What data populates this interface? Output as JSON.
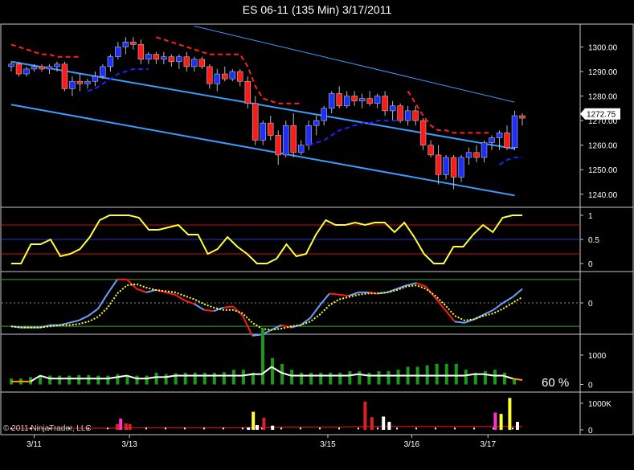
{
  "title": "ES 06-11 (135 Min)  3/17/2011",
  "copyright": "© 2011 NinjaTrader, LLC",
  "colors": {
    "up": "#1e2eff",
    "down": "#ff1a1a",
    "channel": "#3a9cff",
    "stop_down": "#ff2020",
    "stop_up": "#2020ff",
    "yellow": "#ffff33",
    "fast": "#6aa0ff",
    "volume": "#1a9a1a"
  },
  "chart_data": [
    {
      "type": "candlestick",
      "ylim": [
        1236,
        1308
      ],
      "yticks": [
        "1300.00",
        "1290.00",
        "1280.00",
        "1270.00",
        "1260.00",
        "1250.00",
        "1240.00"
      ],
      "last_price": "1272.75",
      "x_labels": [
        "3/11",
        "3/13",
        "3/15",
        "3/16",
        "3/17"
      ],
      "candles": [
        [
          1292,
          1294,
          1290,
          1293
        ],
        [
          1293,
          1294,
          1288,
          1289
        ],
        [
          1289,
          1292,
          1288,
          1291
        ],
        [
          1291,
          1293,
          1290,
          1292
        ],
        [
          1292,
          1293,
          1290,
          1291
        ],
        [
          1291,
          1293,
          1289,
          1292
        ],
        [
          1292,
          1294,
          1290,
          1293
        ],
        [
          1293,
          1294,
          1282,
          1283
        ],
        [
          1283,
          1288,
          1280,
          1286
        ],
        [
          1286,
          1289,
          1282,
          1285
        ],
        [
          1285,
          1287,
          1283,
          1286
        ],
        [
          1286,
          1290,
          1284,
          1288
        ],
        [
          1288,
          1293,
          1287,
          1292
        ],
        [
          1292,
          1297,
          1290,
          1296
        ],
        [
          1296,
          1302,
          1295,
          1300
        ],
        [
          1300,
          1304,
          1297,
          1302
        ],
        [
          1302,
          1304,
          1299,
          1301
        ],
        [
          1301,
          1303,
          1293,
          1295
        ],
        [
          1295,
          1298,
          1293,
          1297
        ],
        [
          1297,
          1298,
          1293,
          1295
        ],
        [
          1295,
          1298,
          1293,
          1296
        ],
        [
          1296,
          1297,
          1292,
          1294
        ],
        [
          1294,
          1297,
          1291,
          1296
        ],
        [
          1296,
          1298,
          1290,
          1292
        ],
        [
          1292,
          1296,
          1290,
          1295
        ],
        [
          1295,
          1296,
          1291,
          1292
        ],
        [
          1292,
          1293,
          1283,
          1285
        ],
        [
          1285,
          1291,
          1282,
          1289
        ],
        [
          1289,
          1292,
          1286,
          1287
        ],
        [
          1287,
          1291,
          1286,
          1290
        ],
        [
          1290,
          1291,
          1284,
          1286
        ],
        [
          1286,
          1288,
          1275,
          1277
        ],
        [
          1277,
          1280,
          1260,
          1262
        ],
        [
          1262,
          1270,
          1260,
          1269
        ],
        [
          1269,
          1272,
          1262,
          1264
        ],
        [
          1264,
          1266,
          1252,
          1256
        ],
        [
          1256,
          1270,
          1255,
          1268
        ],
        [
          1268,
          1273,
          1255,
          1257
        ],
        [
          1257,
          1262,
          1256,
          1260
        ],
        [
          1260,
          1270,
          1258,
          1268
        ],
        [
          1268,
          1272,
          1264,
          1270
        ],
        [
          1270,
          1276,
          1268,
          1275
        ],
        [
          1275,
          1282,
          1273,
          1281
        ],
        [
          1281,
          1284,
          1275,
          1276
        ],
        [
          1276,
          1282,
          1275,
          1280
        ],
        [
          1280,
          1282,
          1276,
          1278
        ],
        [
          1278,
          1281,
          1275,
          1279
        ],
        [
          1279,
          1282,
          1276,
          1277
        ],
        [
          1277,
          1281,
          1275,
          1280
        ],
        [
          1280,
          1282,
          1272,
          1274
        ],
        [
          1274,
          1278,
          1270,
          1276
        ],
        [
          1276,
          1277,
          1269,
          1270
        ],
        [
          1270,
          1276,
          1268,
          1274
        ],
        [
          1274,
          1276,
          1268,
          1270
        ],
        [
          1270,
          1271,
          1258,
          1260
        ],
        [
          1260,
          1262,
          1255,
          1256
        ],
        [
          1256,
          1260,
          1244,
          1248
        ],
        [
          1248,
          1256,
          1246,
          1255
        ],
        [
          1255,
          1256,
          1242,
          1247
        ],
        [
          1247,
          1256,
          1245,
          1255
        ],
        [
          1255,
          1259,
          1252,
          1257
        ],
        [
          1257,
          1260,
          1253,
          1255
        ],
        [
          1255,
          1262,
          1253,
          1261
        ],
        [
          1261,
          1264,
          1258,
          1263
        ],
        [
          1263,
          1266,
          1258,
          1265
        ],
        [
          1265,
          1268,
          1258,
          1259
        ],
        [
          1259,
          1274,
          1258,
          1272
        ],
        [
          1272,
          1273,
          1268,
          1271
        ]
      ],
      "channel_lines": [
        {
          "from": [
            0,
            1294.0
          ],
          "to": [
            66,
            1258.5
          ]
        },
        {
          "from": [
            24,
            1308.5
          ],
          "to": [
            66,
            1277.5
          ]
        },
        {
          "from": [
            0,
            1276.5
          ],
          "to": [
            66,
            1239.5
          ]
        }
      ],
      "stop_down": [
        [
          0,
          1301
        ],
        [
          1,
          1300
        ],
        [
          2,
          1299
        ],
        [
          3,
          1298
        ],
        [
          4,
          1297
        ],
        [
          5,
          1297
        ],
        [
          6,
          1296
        ],
        [
          7,
          1296
        ],
        [
          8,
          1296
        ],
        [
          9,
          1296
        ],
        [
          19,
          1304
        ],
        [
          20,
          1303
        ],
        [
          21,
          1302
        ],
        [
          22,
          1301
        ],
        [
          23,
          1300
        ],
        [
          24,
          1299
        ],
        [
          25,
          1298
        ],
        [
          26,
          1297
        ],
        [
          27,
          1297
        ],
        [
          28,
          1297
        ],
        [
          29,
          1297
        ],
        [
          30,
          1297
        ],
        [
          31,
          1292
        ],
        [
          32,
          1284
        ],
        [
          33,
          1279
        ],
        [
          34,
          1278
        ],
        [
          35,
          1277
        ],
        [
          36,
          1277
        ],
        [
          37,
          1277
        ],
        [
          38,
          1277
        ],
        [
          52,
          1282
        ],
        [
          53,
          1277
        ],
        [
          54,
          1272
        ],
        [
          55,
          1268
        ],
        [
          56,
          1266
        ],
        [
          57,
          1266
        ],
        [
          58,
          1265
        ],
        [
          59,
          1265
        ],
        [
          60,
          1265
        ],
        [
          61,
          1265
        ],
        [
          62,
          1265
        ],
        [
          63,
          1265
        ]
      ],
      "stop_up": [
        [
          10,
          1282
        ],
        [
          11,
          1283
        ],
        [
          12,
          1285
        ],
        [
          13,
          1287
        ],
        [
          14,
          1289
        ],
        [
          15,
          1290
        ],
        [
          16,
          1291
        ],
        [
          17,
          1291
        ],
        [
          18,
          1291
        ],
        [
          39,
          1260
        ],
        [
          40,
          1261
        ],
        [
          41,
          1262
        ],
        [
          42,
          1264
        ],
        [
          43,
          1266
        ],
        [
          44,
          1267
        ],
        [
          45,
          1268
        ],
        [
          46,
          1269
        ],
        [
          47,
          1269
        ],
        [
          48,
          1270
        ],
        [
          49,
          1270
        ],
        [
          50,
          1270
        ],
        [
          51,
          1270
        ],
        [
          64,
          1252
        ],
        [
          65,
          1254
        ],
        [
          66,
          1255
        ],
        [
          67,
          1255
        ]
      ]
    },
    {
      "type": "line",
      "ylim": [
        -0.1,
        1.1
      ],
      "yticks": [
        "1",
        "0.5",
        "0"
      ],
      "levels": [
        0.8,
        0.5,
        0.2
      ],
      "values": [
        0,
        0,
        0.4,
        0.4,
        0.5,
        0.15,
        0.2,
        0.3,
        0.55,
        0.9,
        1,
        1,
        1,
        0.95,
        0.7,
        0.7,
        0.75,
        0.8,
        0.6,
        0.6,
        0.2,
        0.3,
        0.55,
        0.35,
        0.2,
        0,
        0,
        0.1,
        0.4,
        0.15,
        0.2,
        0.6,
        0.9,
        0.8,
        0.8,
        0.85,
        0.8,
        0.85,
        0.85,
        0.65,
        0.85,
        0.55,
        0.2,
        0,
        0,
        0.35,
        0.35,
        0.6,
        0.8,
        0.65,
        0.95,
        1,
        1
      ]
    },
    {
      "type": "line",
      "ylim": [
        -1.2,
        1.2
      ],
      "yticks": [
        "0"
      ],
      "levels": [
        1,
        0,
        -1
      ],
      "fast": [
        -1,
        -1.05,
        -1.05,
        -1.05,
        -0.95,
        -0.95,
        -0.85,
        -0.75,
        -0.55,
        -0.25,
        0.4,
        1,
        1,
        0.6,
        0.45,
        0.55,
        0.45,
        0.35,
        0.1,
        -0.05,
        -0.3,
        -0.35,
        -0.2,
        -0.15,
        -0.55,
        -1.4,
        -1.35,
        -1.15,
        -0.95,
        -1.05,
        -0.95,
        -0.65,
        -0.1,
        0.4,
        0.35,
        0.3,
        0.45,
        0.45,
        0.4,
        0.45,
        0.6,
        0.75,
        0.85,
        0.7,
        0.2,
        -0.3,
        -0.8,
        -0.85,
        -0.7,
        -0.5,
        -0.3,
        0,
        0.25,
        0.6
      ],
      "fast_color": [
        "b",
        "b",
        "b",
        "b",
        "b",
        "b",
        "b",
        "b",
        "b",
        "b",
        "b",
        "b",
        "r",
        "r",
        "r",
        "b",
        "r",
        "r",
        "r",
        "r",
        "b",
        "r",
        "b",
        "r",
        "r",
        "r",
        "b",
        "b",
        "b",
        "r",
        "b",
        "b",
        "b",
        "b",
        "r",
        "r",
        "b",
        "b",
        "r",
        "b",
        "b",
        "b",
        "b",
        "r",
        "r",
        "r",
        "r",
        "b",
        "b",
        "b",
        "b",
        "b",
        "b",
        "b"
      ],
      "signal": [
        -1,
        -1.05,
        -1.05,
        -1.05,
        -1.0,
        -0.95,
        -0.95,
        -0.9,
        -0.8,
        -0.6,
        -0.2,
        0.4,
        0.75,
        0.8,
        0.65,
        0.55,
        0.5,
        0.45,
        0.3,
        0.15,
        -0.05,
        -0.2,
        -0.3,
        -0.3,
        -0.45,
        -0.85,
        -1.1,
        -1.15,
        -1.1,
        -1.0,
        -0.95,
        -0.8,
        -0.5,
        -0.1,
        0.15,
        0.25,
        0.35,
        0.4,
        0.4,
        0.45,
        0.55,
        0.7,
        0.75,
        0.6,
        0.3,
        -0.1,
        -0.55,
        -0.75,
        -0.7,
        -0.55,
        -0.45,
        -0.25,
        0,
        0.25
      ]
    },
    {
      "type": "bar",
      "ylim": [
        -150,
        1600
      ],
      "yticks": [
        "1000",
        "0"
      ],
      "label": "60 %",
      "values": [
        200,
        200,
        250,
        300,
        300,
        300,
        300,
        320,
        320,
        300,
        300,
        350,
        300,
        300,
        300,
        400,
        350,
        380,
        400,
        400,
        400,
        400,
        420,
        500,
        500,
        400,
        1900,
        900,
        700,
        500,
        400,
        400,
        400,
        400,
        400,
        450,
        450,
        400,
        450,
        450,
        500,
        600,
        600,
        650,
        700,
        700,
        700,
        500,
        400,
        450,
        500,
        400,
        200
      ],
      "line_values": [
        100,
        100,
        100,
        300,
        200,
        200,
        200,
        200,
        200,
        200,
        200,
        250,
        300,
        200,
        200,
        250,
        250,
        300,
        300,
        300,
        300,
        300,
        300,
        300,
        300,
        350,
        350,
        600,
        400,
        300,
        300,
        300,
        300,
        300,
        300,
        300,
        350,
        300,
        300,
        300,
        300,
        300,
        300,
        300,
        300,
        300,
        300,
        300,
        350,
        350,
        300,
        300,
        200,
        150
      ],
      "line_white": [
        false,
        false,
        false,
        true,
        true,
        true,
        true,
        true,
        true,
        true,
        true,
        true,
        true,
        true,
        true,
        true,
        true,
        true,
        true,
        true,
        true,
        true,
        true,
        true,
        true,
        true,
        true,
        true,
        true,
        true,
        true,
        true,
        true,
        true,
        true,
        true,
        true,
        true,
        true,
        true,
        true,
        true,
        true,
        true,
        true,
        true,
        true,
        true,
        true,
        true,
        true,
        true,
        true,
        false
      ]
    },
    {
      "type": "bar",
      "ylim": [
        -60,
        1300
      ],
      "yticks": [
        "1000K",
        "0"
      ],
      "bars": [
        [
          11,
          220,
          "#dd2222"
        ],
        [
          11.35,
          420,
          "#ff33cc"
        ],
        [
          11.9,
          240,
          "#dd2222"
        ],
        [
          12.3,
          220,
          "#dd2222"
        ],
        [
          24.6,
          90,
          "#ffffff"
        ],
        [
          25.1,
          680,
          "#ffff33"
        ],
        [
          25.5,
          180,
          "#ffffff"
        ],
        [
          26.2,
          460,
          "#dd2222"
        ],
        [
          27.1,
          160,
          "#ffffff"
        ],
        [
          36.7,
          1060,
          "#dd2222"
        ],
        [
          37.4,
          480,
          "#dd2222"
        ],
        [
          38.6,
          500,
          "#ffffff"
        ],
        [
          39.2,
          300,
          "#ffffff"
        ],
        [
          50.2,
          650,
          "#ff33cc"
        ],
        [
          50.8,
          600,
          "#ffff33"
        ],
        [
          51.7,
          1200,
          "#ffff33"
        ],
        [
          52.5,
          300,
          "#ffffff"
        ]
      ],
      "line_values": [
        50,
        50,
        50,
        50,
        50,
        50,
        60,
        60,
        60,
        60,
        60,
        70,
        80,
        80,
        80,
        80,
        80,
        80,
        80,
        80,
        80,
        80,
        80,
        80,
        80,
        90,
        90,
        100,
        100,
        100,
        100,
        100,
        100,
        100,
        100,
        110,
        120,
        120,
        130,
        130,
        130,
        130,
        130,
        130,
        130,
        130,
        130,
        130,
        130,
        130,
        130,
        130,
        130,
        130
      ]
    }
  ]
}
